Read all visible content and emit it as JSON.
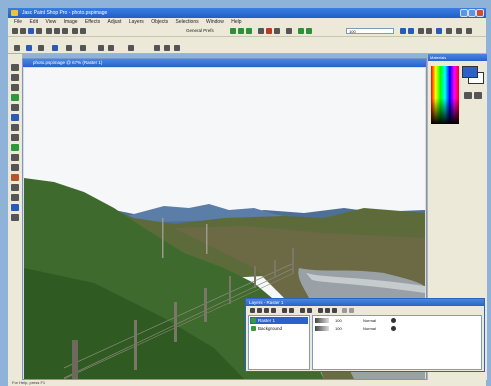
{
  "app": {
    "title": "Jasc Paint Shop Pro - photo.pspimage"
  },
  "menu": [
    "File",
    "Edit",
    "View",
    "Image",
    "Effects",
    "Adjust",
    "Layers",
    "Objects",
    "Selections",
    "Window",
    "Help"
  ],
  "toolbar": {
    "preset_label": "General Prefs",
    "zoom_value": "100"
  },
  "document": {
    "title": "photo.pspimage @ 67% (Raster 1)"
  },
  "materials": {
    "title": "Materials",
    "foreground_color": "#2a62c8",
    "background_color": "#ffffff"
  },
  "layers_palette": {
    "title": "Layers - Raster 1",
    "layers": [
      {
        "name": "Raster 1",
        "selected": true,
        "opacity": "100",
        "blend": "Normal"
      },
      {
        "name": "Background",
        "selected": false,
        "opacity": "100",
        "blend": "Normal"
      }
    ]
  },
  "status": {
    "text": "For Help, press F1"
  },
  "colors": {
    "accent": "#2a62c8",
    "panel": "#ece9d8",
    "desktop": "#8fb2d8"
  }
}
